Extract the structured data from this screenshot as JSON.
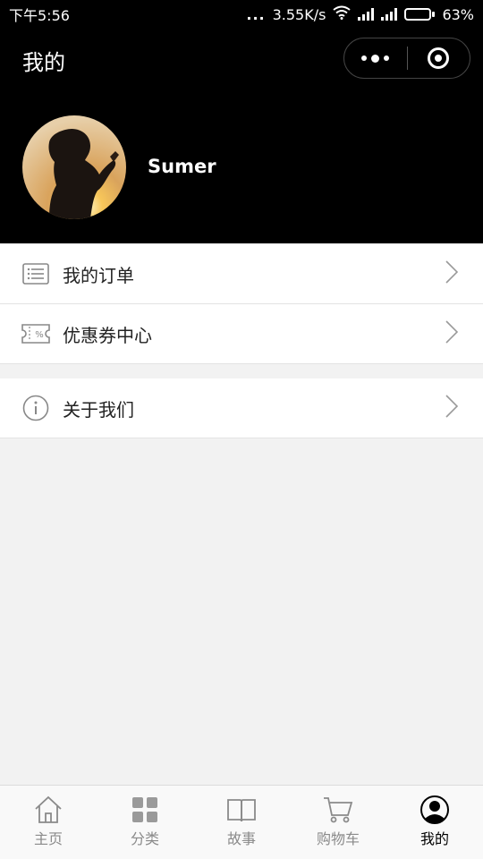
{
  "status_bar": {
    "time": "下午5:56",
    "dots": "...",
    "speed": "3.55K/s",
    "battery": "63%",
    "battery_level": 0.63
  },
  "header": {
    "title": "我的",
    "username": "Sumer"
  },
  "menu": {
    "orders": "我的订单",
    "coupons": "优惠券中心",
    "about": "关于我们"
  },
  "tabs": [
    {
      "label": "主页",
      "icon": "home-icon"
    },
    {
      "label": "分类",
      "icon": "grid-icon"
    },
    {
      "label": "故事",
      "icon": "book-icon"
    },
    {
      "label": "购物车",
      "icon": "cart-icon"
    },
    {
      "label": "我的",
      "icon": "user-icon",
      "active": true
    }
  ],
  "colors": {
    "header_bg": "#000000",
    "page_bg": "#f2f2f2",
    "tab_inactive": "#8a8a8a",
    "tab_active": "#000000"
  }
}
